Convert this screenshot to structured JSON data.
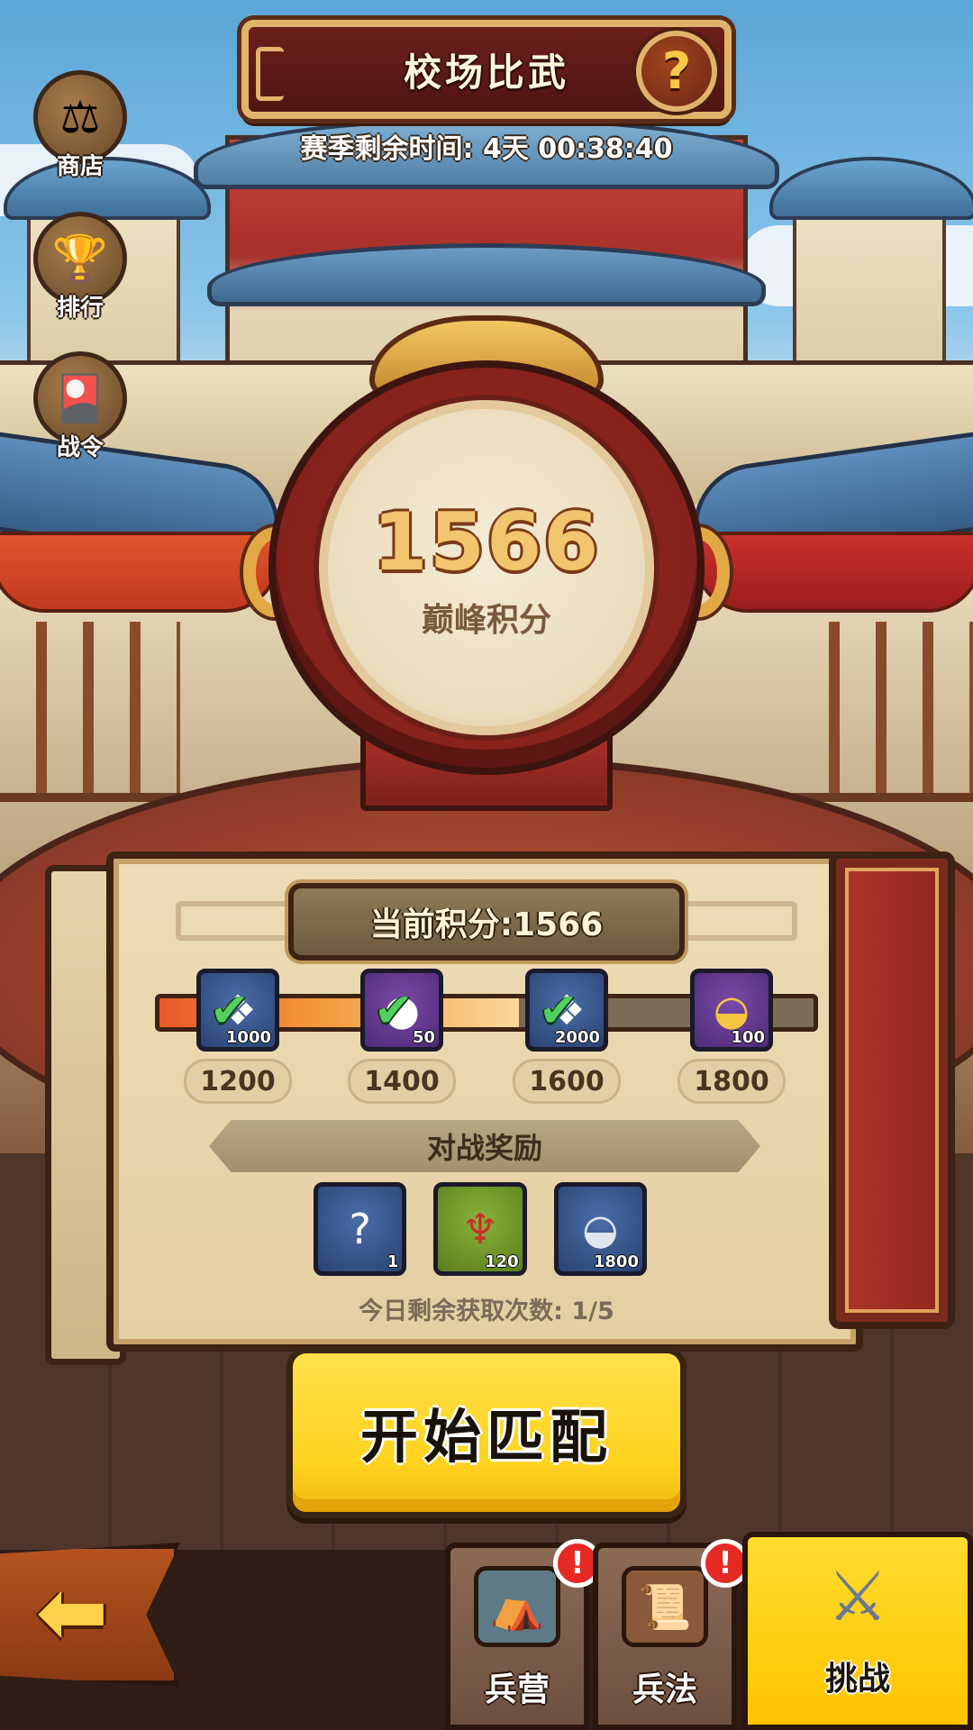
{
  "header": {
    "title": "校场比武",
    "help_icon": "?",
    "season_time": "赛季剩余时间: 4天 00:38:40"
  },
  "side_menu": [
    {
      "label": "商店",
      "icon": "shop-icon"
    },
    {
      "label": "排行",
      "icon": "ranking-icon"
    },
    {
      "label": "战令",
      "icon": "battle-pass-icon"
    }
  ],
  "drum": {
    "score": "1566",
    "label": "巅峰积分"
  },
  "panel": {
    "current_score": "当前积分:1566",
    "progress_fraction": 0.55,
    "milestones": [
      {
        "threshold": "1200",
        "qty": "1000",
        "icon": "jade-token-icon",
        "claimed": true
      },
      {
        "threshold": "1400",
        "qty": "50",
        "icon": "seed-pouch-icon",
        "claimed": true
      },
      {
        "threshold": "1600",
        "qty": "2000",
        "icon": "jade-token-icon",
        "claimed": true
      },
      {
        "threshold": "1800",
        "qty": "100",
        "icon": "gold-ingot-icon",
        "claimed": false
      }
    ],
    "battle_rewards_title": "对战奖励",
    "battle_rewards": [
      {
        "qty": "1",
        "icon": "mystery-scroll-icon"
      },
      {
        "qty": "120",
        "icon": "gourd-icon"
      },
      {
        "qty": "1800",
        "icon": "silver-ingot-icon"
      }
    ],
    "remaining_today": "今日剩余获取次数: 1/5"
  },
  "start_button": "开始匹配",
  "bottom_tabs": [
    {
      "label": "兵营",
      "icon": "barracks-icon",
      "alert": "!"
    },
    {
      "label": "兵法",
      "icon": "tactics-icon",
      "alert": "!"
    },
    {
      "label": "挑战",
      "icon": "crossed-swords-icon",
      "active": true
    }
  ],
  "colors": {
    "accent_yellow": "#ffd21e",
    "banner_red": "#6b1f1a",
    "gold_trim": "#e1b36a"
  }
}
